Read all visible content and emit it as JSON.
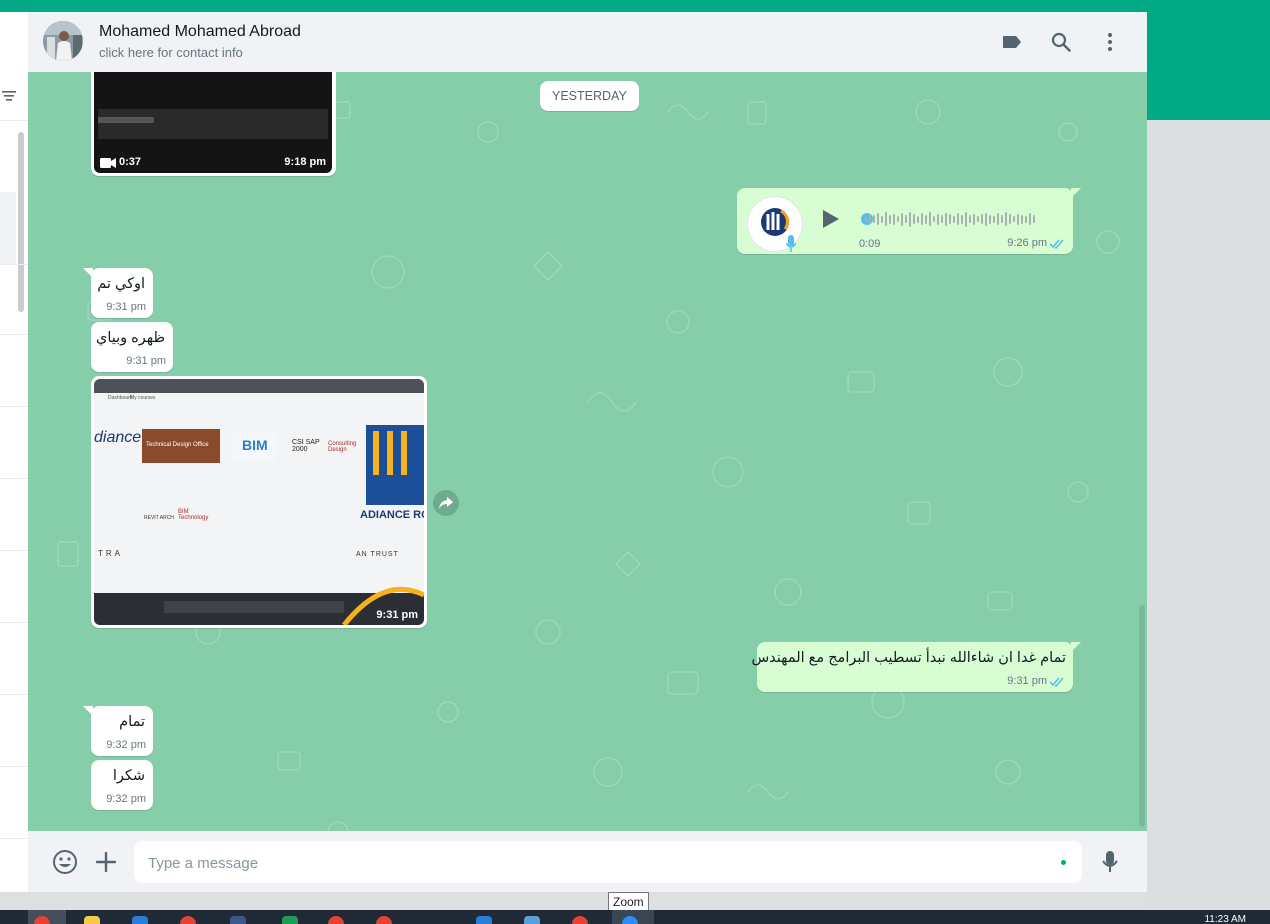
{
  "header": {
    "contact_name": "Mohamed Mohamed Abroad",
    "contact_subtitle": "click here for contact info",
    "icons": [
      "label-icon",
      "search-icon",
      "menu-icon"
    ]
  },
  "chat": {
    "date_chip": "YESTERDAY",
    "video": {
      "duration": "0:37",
      "time": "9:18 pm"
    },
    "audio": {
      "duration": "0:09",
      "time": "9:26 pm",
      "status": "read",
      "avatar_caption": "RADIANCE GROUP"
    },
    "messages": [
      {
        "text": "اوكي تم",
        "time": "9:31 pm",
        "dir": "in"
      },
      {
        "text": "ظهره وبياي",
        "time": "9:31 pm",
        "dir": "in"
      }
    ],
    "photo": {
      "time": "9:31 pm",
      "screen_text": {
        "tab": "Dashboard",
        "tab2": "My courses",
        "course1": "Technical Design Office",
        "course2": "BIM",
        "course3": "CSI SAP 2000",
        "course4": "Consulting Design",
        "course5": "REVIT ARCH",
        "course6": "BIM Technology",
        "brand": "ADIANCE ROUP",
        "brand_left": "diance",
        "bottom_left": "TRA",
        "bottom_right": "AN TRUST"
      }
    },
    "out_message": {
      "text": "تمام غدا ان شاءالله نبدأ تسطيب البرامج مع المهندس",
      "time": "9:31 pm",
      "status": "read"
    },
    "later_messages": [
      {
        "text": "تمام",
        "time": "9:32 pm",
        "dir": "in"
      },
      {
        "text": "شكرا",
        "time": "9:32 pm",
        "dir": "in"
      }
    ]
  },
  "footer": {
    "placeholder": "Type a message",
    "icons": [
      "emoji-icon",
      "attach-plus-icon",
      "microphone-icon"
    ]
  },
  "tooltip": "Zoom",
  "taskbar": {
    "clock": "11:23 AM"
  },
  "colors": {
    "accent": "#00a884",
    "chat_bg": "#86cda9",
    "out_bubble": "#d9fdd3",
    "read_tick": "#53bdeb"
  }
}
